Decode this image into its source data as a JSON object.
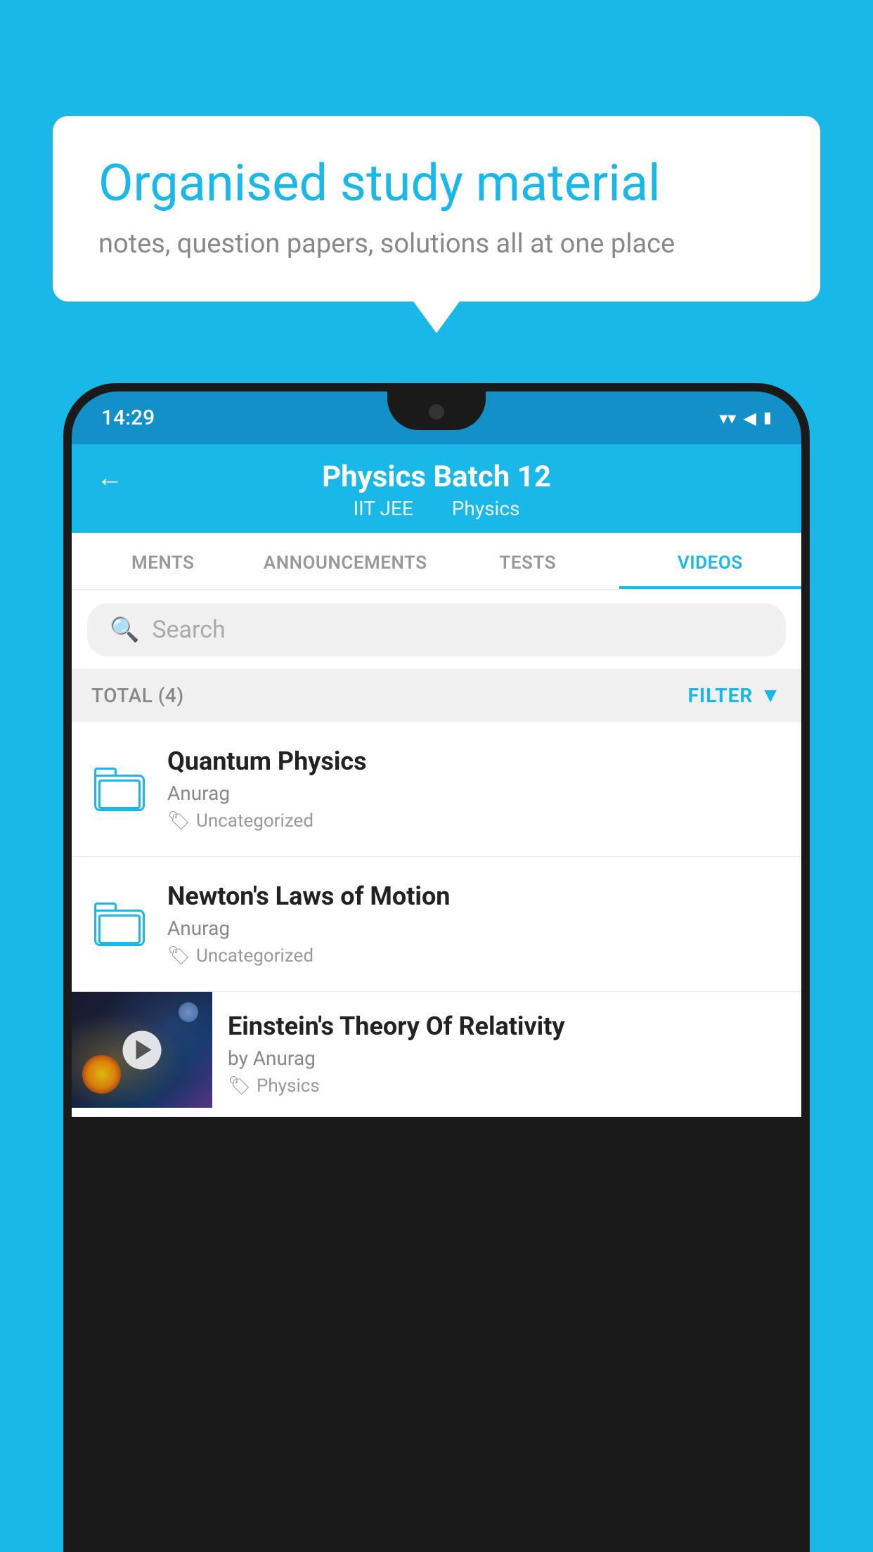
{
  "background_color": "#1ab8e8",
  "bubble": {
    "title": "Organised study material",
    "subtitle": "notes, question papers, solutions all at one place"
  },
  "status_bar": {
    "time": "14:29",
    "wifi": "▾",
    "signal": "◀",
    "battery": "▮"
  },
  "app_bar": {
    "title": "Physics Batch 12",
    "subtitle_part1": "IIT JEE",
    "subtitle_part2": "Physics",
    "back_label": "←"
  },
  "tabs": [
    {
      "label": "MENTS",
      "active": false
    },
    {
      "label": "ANNOUNCEMENTS",
      "active": false
    },
    {
      "label": "TESTS",
      "active": false
    },
    {
      "label": "VIDEOS",
      "active": true
    }
  ],
  "search": {
    "placeholder": "Search"
  },
  "filter_row": {
    "total_label": "TOTAL (4)",
    "filter_label": "FILTER"
  },
  "list_items": [
    {
      "title": "Quantum Physics",
      "author": "Anurag",
      "tag": "Uncategorized",
      "type": "folder"
    },
    {
      "title": "Newton's Laws of Motion",
      "author": "Anurag",
      "tag": "Uncategorized",
      "type": "folder"
    },
    {
      "title": "Einstein's Theory Of Relativity",
      "author": "by Anurag",
      "tag": "Physics",
      "type": "video"
    }
  ]
}
